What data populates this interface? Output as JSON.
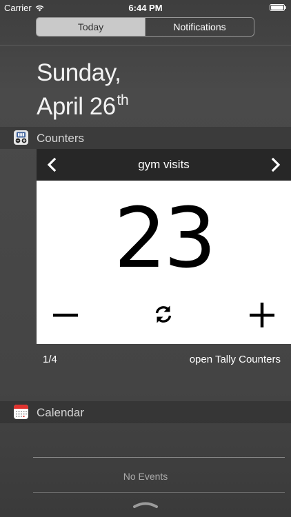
{
  "status_bar": {
    "carrier": "Carrier",
    "time": "6:44 PM",
    "wifi_icon": "wifi-icon",
    "battery_icon": "battery-icon"
  },
  "segments": [
    {
      "label": "Today",
      "selected": true
    },
    {
      "label": "Notifications",
      "selected": false
    }
  ],
  "date": {
    "weekday": "Sunday,",
    "month_day": "April 26",
    "suffix": "th"
  },
  "counters_section": {
    "title": "Counters",
    "icon": "tally-counters-app-icon",
    "counter_name": "gym visits",
    "value": "23",
    "page_indicator": "1/4",
    "open_link": "open Tally Counters",
    "prev_icon": "chevron-left-icon",
    "next_icon": "chevron-right-icon",
    "minus_icon": "minus-icon",
    "reset_icon": "refresh-icon",
    "plus_icon": "plus-icon"
  },
  "calendar_section": {
    "title": "Calendar",
    "icon": "calendar-app-icon",
    "empty_text": "No Events"
  },
  "colors": {
    "background": "#454545",
    "nav_bar": "#272727",
    "card": "#ffffff",
    "segment_selected": "#c9c9c9"
  }
}
